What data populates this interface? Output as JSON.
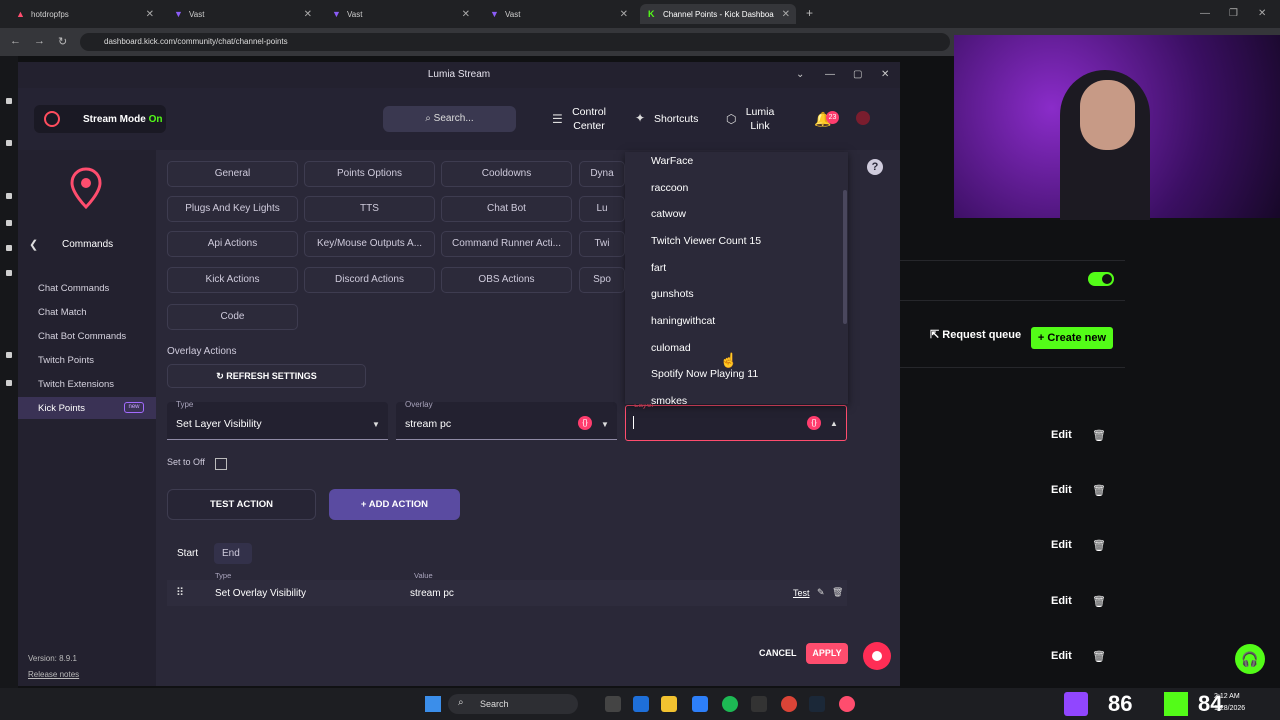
{
  "browser": {
    "tabs": [
      {
        "label": "hotdropfps",
        "icon": "lumia-icon"
      },
      {
        "label": "Vast",
        "icon": "vast-icon"
      },
      {
        "label": "Vast",
        "icon": "vast-icon"
      },
      {
        "label": "Vast",
        "icon": "vast-icon"
      },
      {
        "label": "Channel Points - Kick Dashboa",
        "icon": "kick-icon"
      }
    ],
    "url": "dashboard.kick.com/community/chat/channel-points"
  },
  "kick": {
    "request_queue": "Request queue",
    "create_new": "+ Create new",
    "edit_label": "Edit",
    "toggle_color": "#53fc18"
  },
  "app": {
    "title": "Lumia Stream",
    "stream_mode": {
      "label": "Stream Mode",
      "state": "On"
    },
    "search": "Search...",
    "header": {
      "control_center": "Control Center",
      "shortcuts": "Shortcuts",
      "lumia_link": "Lumia Link",
      "notif_count": "23"
    },
    "sidebar": {
      "title": "Commands",
      "items": [
        "Chat Commands",
        "Chat Match",
        "Chat Bot Commands",
        "Twitch Points",
        "Twitch Extensions",
        "Kick Points"
      ],
      "new_badge": "new",
      "version": "Version: 8.9.1",
      "release_notes": "Release notes"
    },
    "categories": [
      [
        "General",
        "Points Options",
        "Cooldowns",
        "Dyna"
      ],
      [
        "Plugs And Key Lights",
        "TTS",
        "Chat Bot",
        "Lu"
      ],
      [
        "Api Actions",
        "Key/Mouse Outputs A...",
        "Command Runner Acti...",
        "Twi"
      ],
      [
        "Kick Actions",
        "Discord Actions",
        "OBS Actions",
        "Spo"
      ],
      [
        "Code"
      ]
    ],
    "overlay_actions": "Overlay Actions",
    "refresh_settings": "REFRESH SETTINGS",
    "fields": {
      "type_label": "Type",
      "type_value": "Set Layer Visibility",
      "overlay_label": "Overlay",
      "overlay_value": "stream pc",
      "layer_label": "Layer"
    },
    "set_to_off": "Set to Off",
    "test_action": "TEST ACTION",
    "add_action": "ADD ACTION",
    "tabs": [
      "Start",
      "End"
    ],
    "table": {
      "col_type": "Type",
      "col_value": "Value",
      "row_type": "Set Overlay Visibility",
      "row_value": "stream pc",
      "row_test": "Test"
    },
    "cancel": "CANCEL",
    "apply": "APPLY",
    "dropdown": [
      "WarFace",
      "raccoon",
      "catwow",
      "Twitch Viewer Count 15",
      "fart",
      "gunshots",
      "haningwithcat",
      "culomad",
      "Spotify Now Playing 11",
      "smokes"
    ],
    "accent": "#ff4d6e"
  },
  "taskbar": {
    "search": "Search",
    "num1": "86",
    "num2": "84",
    "time": "2:12 AM",
    "date": "1/28/2026"
  }
}
